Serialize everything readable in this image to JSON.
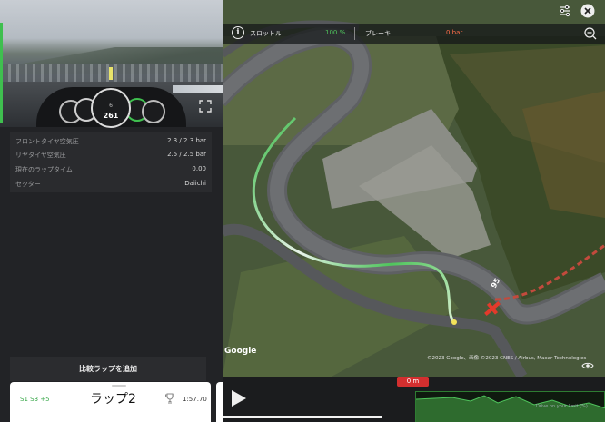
{
  "dashboard": {
    "gear_label": "6",
    "speed": "261"
  },
  "info_rows": [
    {
      "label": "フロントタイヤ空気圧",
      "value": "2.3 / 2.3 bar"
    },
    {
      "label": "リヤタイヤ空気圧",
      "value": "2.5 / 2.5 bar"
    },
    {
      "label": "現在のラップタイム",
      "value": "0.00"
    },
    {
      "label": "セクター",
      "value": "Daiichi"
    }
  ],
  "add_comparison": "比較ラップを追加",
  "lap_card": {
    "sectors": "S1 S3 +5",
    "name": "ラップ2",
    "time": "1:57.70"
  },
  "telemetry": {
    "throttle_label": "スロットル",
    "throttle_value": "100 %",
    "brake_label": "ブレーキ",
    "brake_value": "0 bar",
    "throttle_color": "#4fc45c",
    "brake_color": "#ff6d4a"
  },
  "map": {
    "google": "Google",
    "credits": "©2023 Google、画像 ©2023 CNES / Airbus, Maxar Technologies",
    "marker_label": "95"
  },
  "timeline": {
    "distance": "0 m",
    "drive_note": "Drive on your limit (%)"
  }
}
